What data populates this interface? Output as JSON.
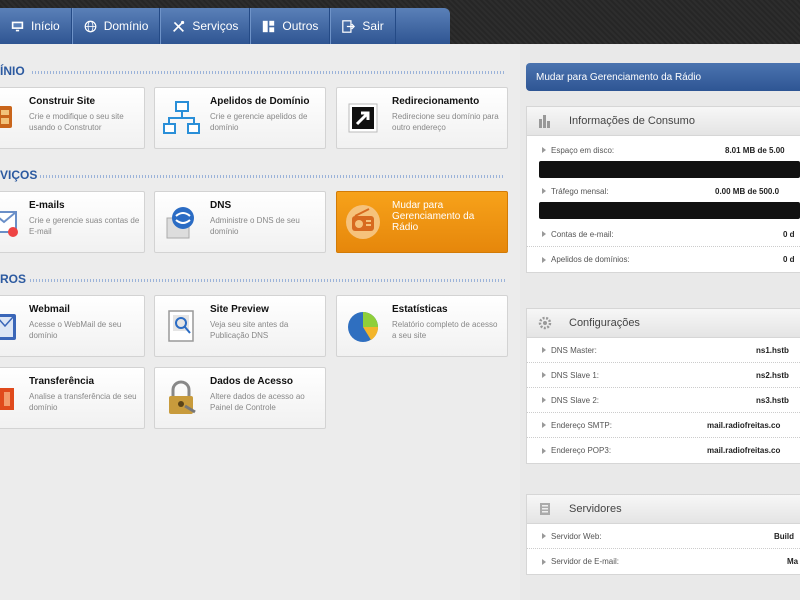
{
  "nav": {
    "tabs": [
      {
        "label": "Início",
        "icon": "monitor-icon"
      },
      {
        "label": "Domínio",
        "icon": "globe-icon"
      },
      {
        "label": "Serviços",
        "icon": "tools-icon"
      },
      {
        "label": "Outros",
        "icon": "grid-icon"
      },
      {
        "label": "Sair",
        "icon": "exit-icon"
      }
    ]
  },
  "sections": {
    "dominio": {
      "title": "ÍNIO",
      "cards": [
        {
          "title": "Construir Site",
          "desc": "Crie e modifique o seu site usando o Construtor",
          "icon": "site-builder-icon"
        },
        {
          "title": "Apelidos de Domínio",
          "desc": "Crie e gerencie apelidos de domínio",
          "icon": "domain-alias-icon"
        },
        {
          "title": "Redirecionamento",
          "desc": "Redirecione seu domínio para outro endereço",
          "icon": "redirect-icon"
        }
      ]
    },
    "servicos": {
      "title": "VIÇOS",
      "cards": [
        {
          "title": "E-mails",
          "desc": "Crie e gerencie suas contas de E-mail",
          "icon": "email-icon"
        },
        {
          "title": "DNS",
          "desc": "Administre o DNS de seu domínio",
          "icon": "dns-icon"
        },
        {
          "title": "Mudar para Gerenciamento da Rádio",
          "desc": "",
          "icon": "radio-icon"
        }
      ]
    },
    "outros": {
      "title": "ROS",
      "cards": [
        {
          "title": "Webmail",
          "desc": "Acesse o WebMail de seu domínio",
          "icon": "webmail-icon"
        },
        {
          "title": "Site Preview",
          "desc": "Veja seu site antes da Publicação DNS",
          "icon": "site-preview-icon"
        },
        {
          "title": "Estatísticas",
          "desc": "Relatório completo de acesso a seu site",
          "icon": "statistics-icon"
        },
        {
          "title": "Transferência",
          "desc": "Analise a transferência de seu domínio",
          "icon": "transfer-icon"
        },
        {
          "title": "Dados de Acesso",
          "desc": "Altere dados de acesso ao Painel de Controle",
          "icon": "lock-icon"
        }
      ]
    }
  },
  "right": {
    "radio_button": "Mudar para Gerenciamento da Rádio",
    "consumo": {
      "title": "Informações de Consumo",
      "rows": [
        {
          "label": "Espaço em disco:",
          "value": "8.01 MB de 5.00"
        },
        {
          "label": "Tráfego mensal:",
          "value": "0.00 MB de 500.0"
        },
        {
          "label": "Contas de e-mail:",
          "value": "0 d"
        },
        {
          "label": "Apelidos de domínios:",
          "value": "0 d"
        }
      ]
    },
    "config": {
      "title": "Configurações",
      "rows": [
        {
          "label": "DNS Master:",
          "value": "ns1.hstb"
        },
        {
          "label": "DNS Slave 1:",
          "value": "ns2.hstb"
        },
        {
          "label": "DNS Slave 2:",
          "value": "ns3.hstb"
        },
        {
          "label": "Endereço SMTP:",
          "value": "mail.radiofreitas.co"
        },
        {
          "label": "Endereço POP3:",
          "value": "mail.radiofreitas.co"
        }
      ]
    },
    "servidores": {
      "title": "Servidores",
      "rows": [
        {
          "label": "Servidor Web:",
          "value": "Build"
        },
        {
          "label": "Servidor de E-mail:",
          "value": "Ma"
        }
      ]
    }
  },
  "colors": {
    "nav_blue": "#3a63a3",
    "section_blue": "#2c5aa0",
    "orange_card": "#f29310"
  }
}
